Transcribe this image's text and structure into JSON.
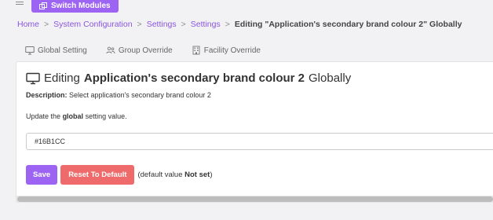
{
  "header": {
    "switch_modules_label": "Switch Modules"
  },
  "breadcrumb": {
    "items": [
      "Home",
      "System Configuration",
      "Settings",
      "Settings"
    ],
    "current": "Editing \"Application's secondary brand colour 2\" Globally"
  },
  "tabs": [
    {
      "label": "Global Setting",
      "icon": "monitor-icon"
    },
    {
      "label": "Group Override",
      "icon": "users-icon"
    },
    {
      "label": "Facility Override",
      "icon": "building-icon"
    }
  ],
  "editor": {
    "title_prefix": "Editing",
    "title_setting": "Application's secondary brand colour 2",
    "title_suffix": "Globally",
    "description_label": "Description:",
    "description_text": "Select application's secondary brand colour 2",
    "update_prefix": "Update the",
    "update_scope": "global",
    "update_suffix": "setting value.",
    "value": "#16B1CC"
  },
  "actions": {
    "save_label": "Save",
    "reset_label": "Reset To Default",
    "default_prefix": "(default value",
    "default_value": "Not set",
    "default_suffix": ")"
  },
  "colors": {
    "accent": "#9d63f3",
    "danger": "#ef6b6b",
    "link": "#8a55e0"
  }
}
